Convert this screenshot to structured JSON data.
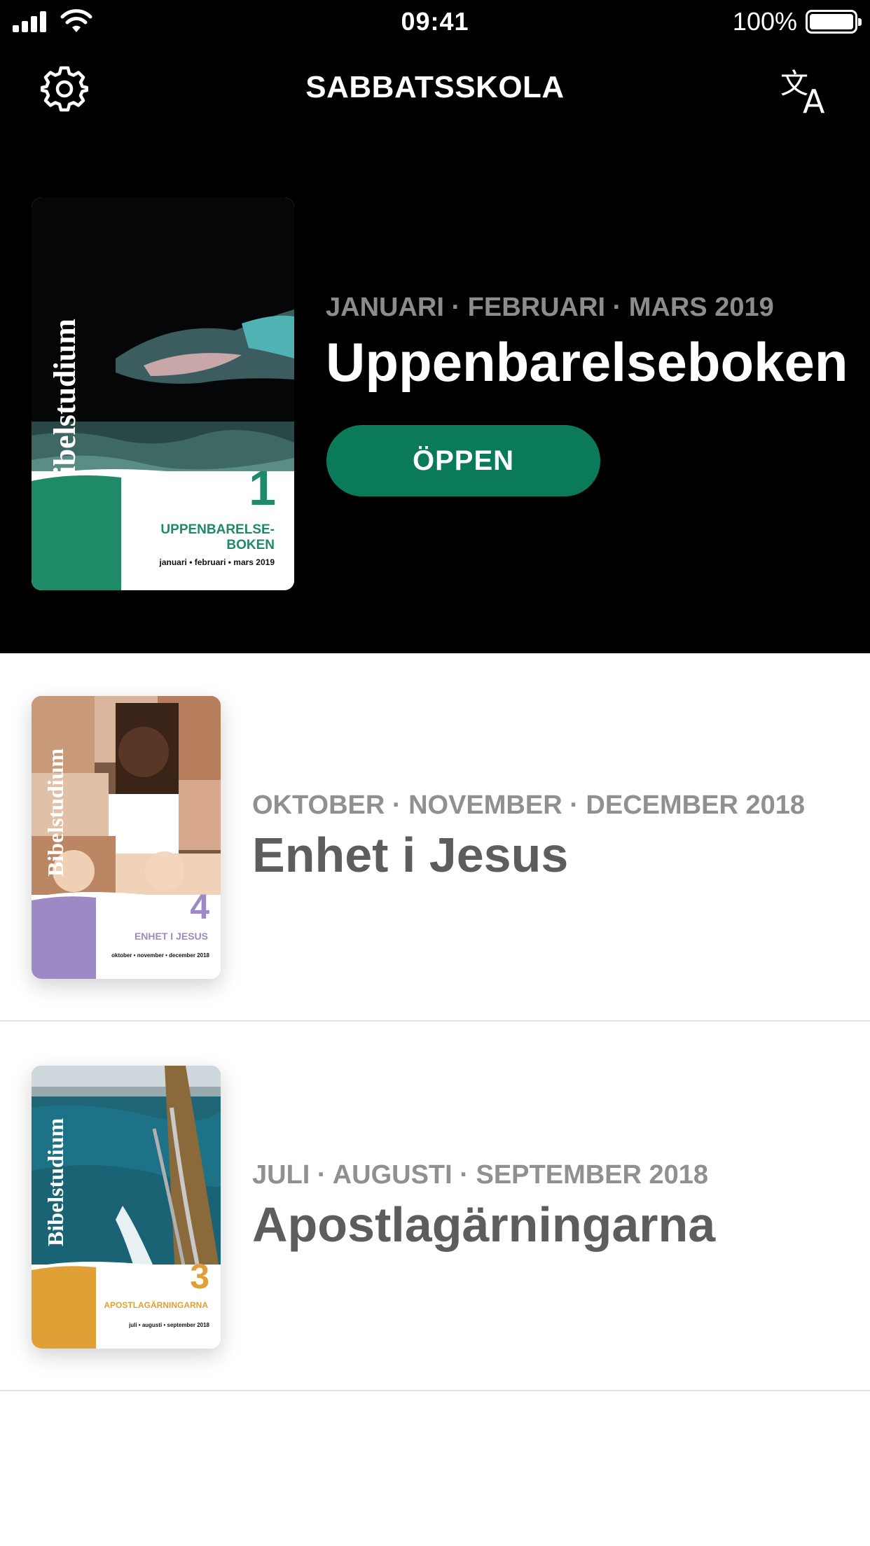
{
  "status_bar": {
    "time": "09:41",
    "battery": "100%"
  },
  "header": {
    "title": "SABBATSSKOLA",
    "settings_icon": "gear-icon",
    "language_icon": "translate-icon"
  },
  "featured": {
    "dates": "JANUARI · FEBRUARI · MARS 2019",
    "title": "Uppenbarelseboken",
    "open_label": "ÖPPEN",
    "cover": {
      "spine": "Bibelstudium",
      "number": "1",
      "title_line1": "UPPENBARELSE-",
      "title_line2": "BOKEN",
      "dates": "januari  •  februari  •  mars 2019",
      "accent": "#1f8a68"
    }
  },
  "quarterlies": [
    {
      "dates": "OKTOBER · NOVEMBER · DECEMBER 2018",
      "title": "Enhet i Jesus",
      "cover": {
        "spine": "Bibelstudium",
        "number": "4",
        "title": "ENHET I JESUS",
        "dates": "oktober • november • december 2018",
        "accent": "#9d8ac4"
      }
    },
    {
      "dates": "JULI · AUGUSTI · SEPTEMBER 2018",
      "title": "Apostlagärningarna",
      "cover": {
        "spine": "Bibelstudium",
        "number": "3",
        "title": "APOSTLAGÄRNINGARNA",
        "dates": "juli  •  augusti  •  september 2018",
        "accent": "#e0a035"
      }
    }
  ]
}
